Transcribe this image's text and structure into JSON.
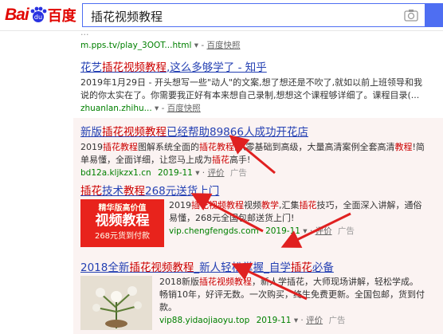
{
  "header": {
    "logo_left": "Bai",
    "logo_right": "百度",
    "query": "插花视频教程"
  },
  "results": [
    {
      "abstract_fragment": "...",
      "url": "m.pps.tv/play_3OOT...html",
      "snapshot": "百度快照"
    },
    {
      "title_parts": [
        "花艺",
        "插花视频教程",
        ",这么多够学了 - 知乎"
      ],
      "abstract": "2019年1月29日 - 开头想写一些\"动人\"的文案,想了想还是不吹了,就如以前上班领导和我说的你太实在了。你需要我正好有本来想自己录制,想想这个课程够详细了。课程目录(...",
      "url": "zhuanlan.zhihu...",
      "snapshot": "百度快照"
    },
    {
      "title_parts": [
        "新版",
        "插花视频教程",
        "已经帮助89866人成功开花店"
      ],
      "abstract_parts": [
        "2019",
        "插花教程",
        "图解系统全面的",
        "插花教程",
        ",从零基础到高级，大量高清案例全套高清",
        "教程",
        "!简单易懂，全面详细，让您马上成为",
        "插花",
        "高手!"
      ],
      "url": "bd12a.kljkzx1.cn",
      "date": "2019-11",
      "eval": "评价",
      "ad": "广告"
    },
    {
      "title_parts": [
        "插花",
        "技术",
        "教程",
        "268元送货上门"
      ],
      "abstract_parts": [
        "2019",
        "插花视频教程",
        "视频",
        "教学",
        ",汇集",
        "插花",
        "技巧，全面深入讲解，通俗易懂，268元全国包邮送货上门!"
      ],
      "url": "vip.chengfengds.com",
      "date": "2019-11",
      "eval": "评价",
      "ad": "广告",
      "banner": {
        "line1": "精华版高价值",
        "line2": "视频教程",
        "line3": "268元货到付款"
      }
    },
    {
      "title_parts": [
        "2018全新",
        "插花视频教程",
        "_新人轻松掌握_自学",
        "插花",
        "必备"
      ],
      "abstract_parts": [
        "2018新版",
        "插花视频教程",
        "，新人学插花，大师现场讲解，轻松学成。畅销10年，好评无数。一次购买，终生免费更新。全国包邮，货到付款。"
      ],
      "url": "vip88.yidaojiaoyu.top",
      "date": "2019-11",
      "eval": "评价",
      "ad": "广告"
    }
  ],
  "colors": {
    "brand": "#e10601",
    "link": "#2440b3",
    "highlight": "#cc0000",
    "url": "#008000",
    "arrow": "#e02020"
  }
}
